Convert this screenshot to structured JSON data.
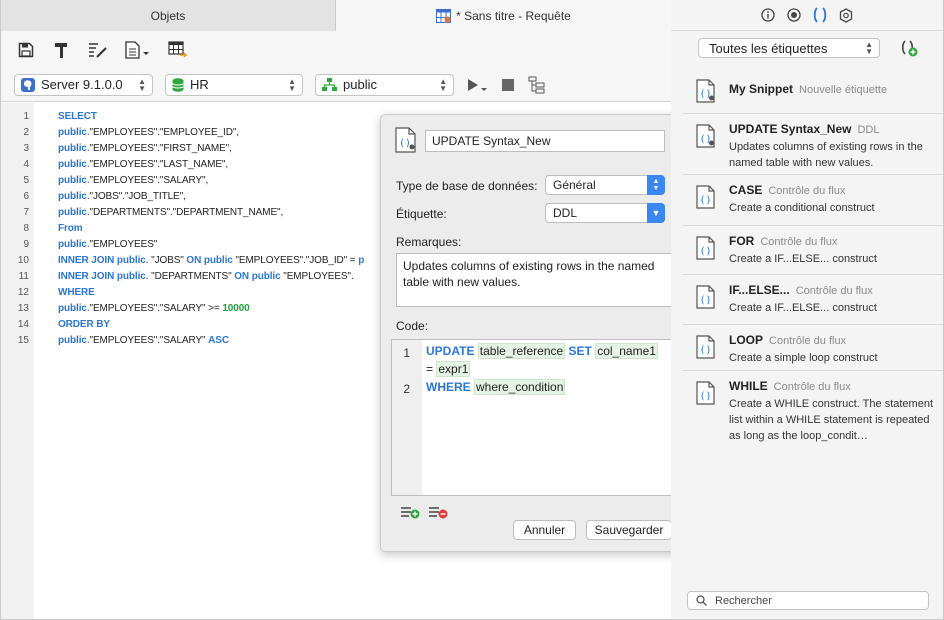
{
  "tabs": [
    {
      "label": "Objets"
    },
    {
      "label": "* Sans titre - Requête"
    }
  ],
  "connection": {
    "server": "Server 9.1.0.0",
    "database": "HR",
    "schema": "public"
  },
  "editor": {
    "line_numbers": [
      "1",
      "2",
      "3",
      "4",
      "5",
      "6",
      "7",
      "8",
      "9",
      "10",
      "11",
      "12",
      "13",
      "14",
      "15"
    ],
    "lines": [
      [
        {
          "t": "SELECT",
          "c": "kw"
        }
      ],
      [
        {
          "t": "public",
          "c": "kw"
        },
        {
          "t": ".\"EMPLOYEES\".\"EMPLOYEE_ID\","
        }
      ],
      [
        {
          "t": "public",
          "c": "kw"
        },
        {
          "t": ".\"EMPLOYEES\".\"FIRST_NAME\","
        }
      ],
      [
        {
          "t": "public",
          "c": "kw"
        },
        {
          "t": ".\"EMPLOYEES\".\"LAST_NAME\","
        }
      ],
      [
        {
          "t": "public",
          "c": "kw"
        },
        {
          "t": ".\"EMPLOYEES\".\"SALARY\","
        }
      ],
      [
        {
          "t": "public",
          "c": "kw"
        },
        {
          "t": ".\"JOBS\".\"JOB_TITLE\","
        }
      ],
      [
        {
          "t": "public",
          "c": "kw"
        },
        {
          "t": ".\"DEPARTMENTS\".\"DEPARTMENT_NAME\","
        }
      ],
      [
        {
          "t": "From",
          "c": "kw"
        }
      ],
      [
        {
          "t": "public",
          "c": "kw"
        },
        {
          "t": ".\"EMPLOYEES\""
        }
      ],
      [
        {
          "t": "INNER JOIN public",
          "c": "kw"
        },
        {
          "t": ". \"JOBS\" "
        },
        {
          "t": "ON public",
          "c": "kw"
        },
        {
          "t": " \"EMPLOYEES\".\"JOB_ID\" = "
        },
        {
          "t": "p",
          "c": "kw"
        }
      ],
      [
        {
          "t": "INNER JOIN public",
          "c": "kw"
        },
        {
          "t": ". \"DEPARTMENTS\" "
        },
        {
          "t": "ON public",
          "c": "kw"
        },
        {
          "t": " \"EMPLOYEES\"."
        }
      ],
      [
        {
          "t": "WHERE",
          "c": "kw"
        }
      ],
      [
        {
          "t": "public",
          "c": "kw"
        },
        {
          "t": ".\"EMPLOYEES\".\"SALARY\" >= "
        },
        {
          "t": "10000",
          "c": "num"
        }
      ],
      [
        {
          "t": "ORDER BY",
          "c": "kw"
        }
      ],
      [
        {
          "t": "public",
          "c": "kw"
        },
        {
          "t": ".\"EMPLOYEES\".\"SALARY\" "
        },
        {
          "t": "ASC",
          "c": "kw"
        }
      ]
    ]
  },
  "popover": {
    "snippet_name": "UPDATE Syntax_New",
    "db_type_label": "Type de base de données:",
    "db_type_value": "Général",
    "tag_label": "Étiquette:",
    "tag_value": "DDL",
    "remarks_label": "Remarques:",
    "remarks_value": "Updates columns of existing rows in the named table with new values.",
    "code_label": "Code:",
    "code_line_numbers": [
      "1",
      "2"
    ],
    "code": {
      "l1_kw1": "UPDATE",
      "l1_ph1": "table_reference",
      "l1_kw2": "SET",
      "l1_ph2": "col_name1",
      "l1b_eq": "=",
      "l1b_ph3": "expr1",
      "l2_kw": "WHERE",
      "l2_ph": "where_condition"
    },
    "cancel_label": "Annuler",
    "save_label": "Sauvegarder"
  },
  "right_panel": {
    "tag_filter": "Toutes les étiquettes",
    "search_placeholder": "Rechercher",
    "snippets": [
      {
        "title": "My Snippet",
        "tag": "Nouvelle étiquette",
        "desc": ""
      },
      {
        "title": "UPDATE Syntax_New",
        "tag": "DDL",
        "desc": "Updates columns of existing rows in the named table with new values."
      },
      {
        "title": "CASE",
        "tag": "Contrôle du flux",
        "desc": "Create a conditional construct"
      },
      {
        "title": "FOR",
        "tag": "Contrôle du flux",
        "desc": "Create a IF...ELSE... construct"
      },
      {
        "title": "IF...ELSE...",
        "tag": "Contrôle du flux",
        "desc": "Create a IF...ELSE... construct"
      },
      {
        "title": "LOOP",
        "tag": "Contrôle du flux",
        "desc": "Create a simple loop construct"
      },
      {
        "title": "WHILE",
        "tag": "Contrôle du flux",
        "desc": "Create a WHILE construct. The statement list within a WHILE statement is repeated as long as the loop_condit…"
      }
    ]
  },
  "colors": {
    "keyword": "#2b77d6",
    "number": "#1fa33b",
    "accent": "#3a86f2",
    "placeholder_bg": "#e5f3e6"
  }
}
